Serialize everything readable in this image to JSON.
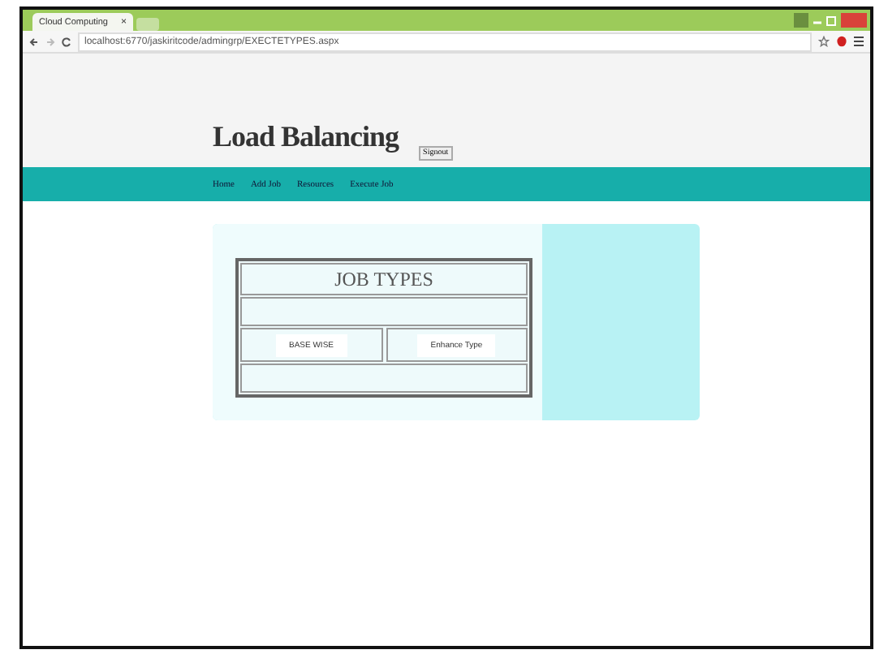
{
  "browser": {
    "tab_title": "Cloud Computing",
    "tab_close": "×",
    "address": "localhost:6770/jaskiritcode/admingrp/EXECTETYPES.aspx"
  },
  "header": {
    "title": "Load Balancing",
    "signout_button": "Signout"
  },
  "nav": {
    "items": [
      {
        "label": "Home"
      },
      {
        "label": "Add Job"
      },
      {
        "label": "Resources"
      },
      {
        "label": "Execute Job"
      }
    ]
  },
  "job_types": {
    "title": "JOB TYPES",
    "buttons": [
      "BASE WISE",
      "Enhance Type"
    ]
  }
}
